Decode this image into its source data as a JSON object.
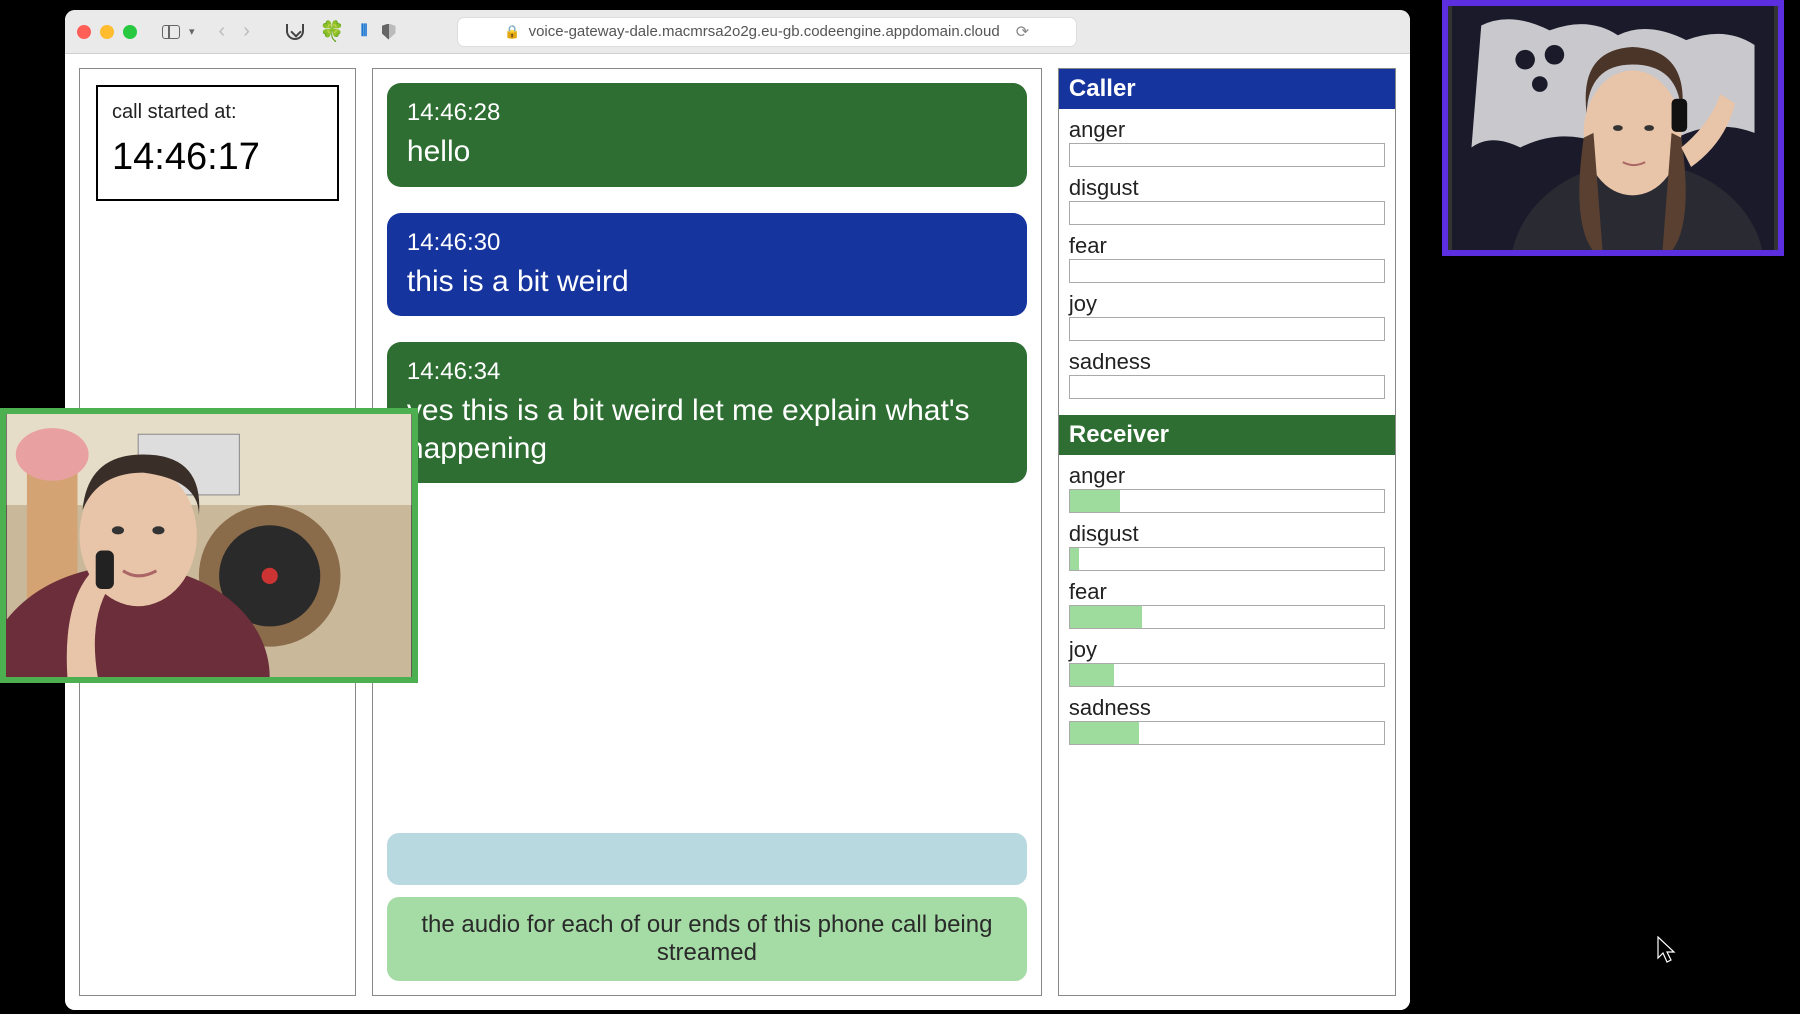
{
  "browser": {
    "url": "voice-gateway-dale.macmrsa2o2g.eu-gb.codeengine.appdomain.cloud"
  },
  "call": {
    "started_label": "call started at:",
    "started_time": "14:46:17"
  },
  "messages": [
    {
      "ts": "14:46:28",
      "text": "hello",
      "side": "green"
    },
    {
      "ts": "14:46:30",
      "text": "this is a bit weird",
      "side": "blue"
    },
    {
      "ts": "14:46:34",
      "text": "yes this is a bit weird let me explain what's happening",
      "side": "green"
    }
  ],
  "interim": {
    "green_text": "the audio for each of our ends of this phone call being streamed"
  },
  "caller": {
    "title": "Caller",
    "emotions": [
      {
        "name": "anger",
        "value": 0
      },
      {
        "name": "disgust",
        "value": 0
      },
      {
        "name": "fear",
        "value": 0
      },
      {
        "name": "joy",
        "value": 0
      },
      {
        "name": "sadness",
        "value": 0
      }
    ]
  },
  "receiver": {
    "title": "Receiver",
    "emotions": [
      {
        "name": "anger",
        "value": 16
      },
      {
        "name": "disgust",
        "value": 3
      },
      {
        "name": "fear",
        "value": 23
      },
      {
        "name": "joy",
        "value": 14
      },
      {
        "name": "sadness",
        "value": 22
      }
    ]
  }
}
